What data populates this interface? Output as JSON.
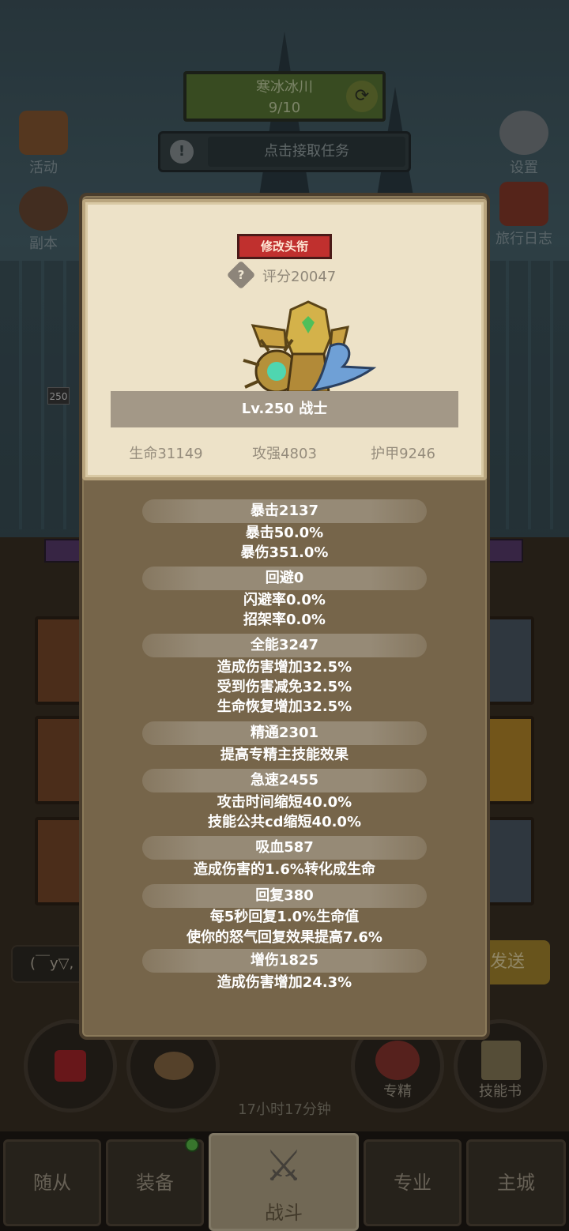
{
  "hud": {
    "zone_name": "寒冰冰川",
    "zone_progress": "9/10",
    "task_text": "点击接取任务",
    "task_icon": "!",
    "left_buttons": [
      "活动",
      "副本"
    ],
    "right_buttons": [
      "设置",
      "旅行日志"
    ],
    "level_badge": "250"
  },
  "popup": {
    "title_button": "修改头衔",
    "score": "评分20047",
    "help_icon": "?",
    "name_line": "Lv.250 战士",
    "basic_stats": [
      "生命31149",
      "攻强4803",
      "护甲9246"
    ],
    "stats": [
      {
        "name": "暴击2137",
        "lines": [
          "暴击50.0%",
          "暴伤351.0%"
        ]
      },
      {
        "name": "回避0",
        "lines": [
          "闪避率0.0%",
          "招架率0.0%"
        ]
      },
      {
        "name": "全能3247",
        "lines": [
          "造成伤害增加32.5%",
          "受到伤害减免32.5%",
          "生命恢复增加32.5%"
        ]
      },
      {
        "name": "精通2301",
        "lines": [
          "提高专精主技能效果"
        ]
      },
      {
        "name": "急速2455",
        "lines": [
          "攻击时间缩短40.0%",
          "技能公共cd缩短40.0%"
        ]
      },
      {
        "name": "吸血587",
        "lines": [
          "造成伤害的1.6%转化成生命"
        ]
      },
      {
        "name": "回复380",
        "lines": [
          "每5秒回复1.0%生命值",
          "使你的怒气回复效果提高7.6%"
        ]
      },
      {
        "name": "增伤1825",
        "lines": [
          "造成伤害增加24.3%"
        ]
      }
    ]
  },
  "bottom": {
    "chat_text": "(￣y▽,",
    "send_label": "发送",
    "circle_labels": [
      "专精",
      "技能书"
    ],
    "chest_timer": "17小时17分钟"
  },
  "nav": {
    "tabs": [
      "随从",
      "装备",
      "战斗",
      "专业",
      "主城"
    ]
  },
  "colors": {
    "title_button": "#c0302e",
    "panel": "#76654a",
    "card": "#ede2c8",
    "notify_dot": "#5bbf4a"
  }
}
